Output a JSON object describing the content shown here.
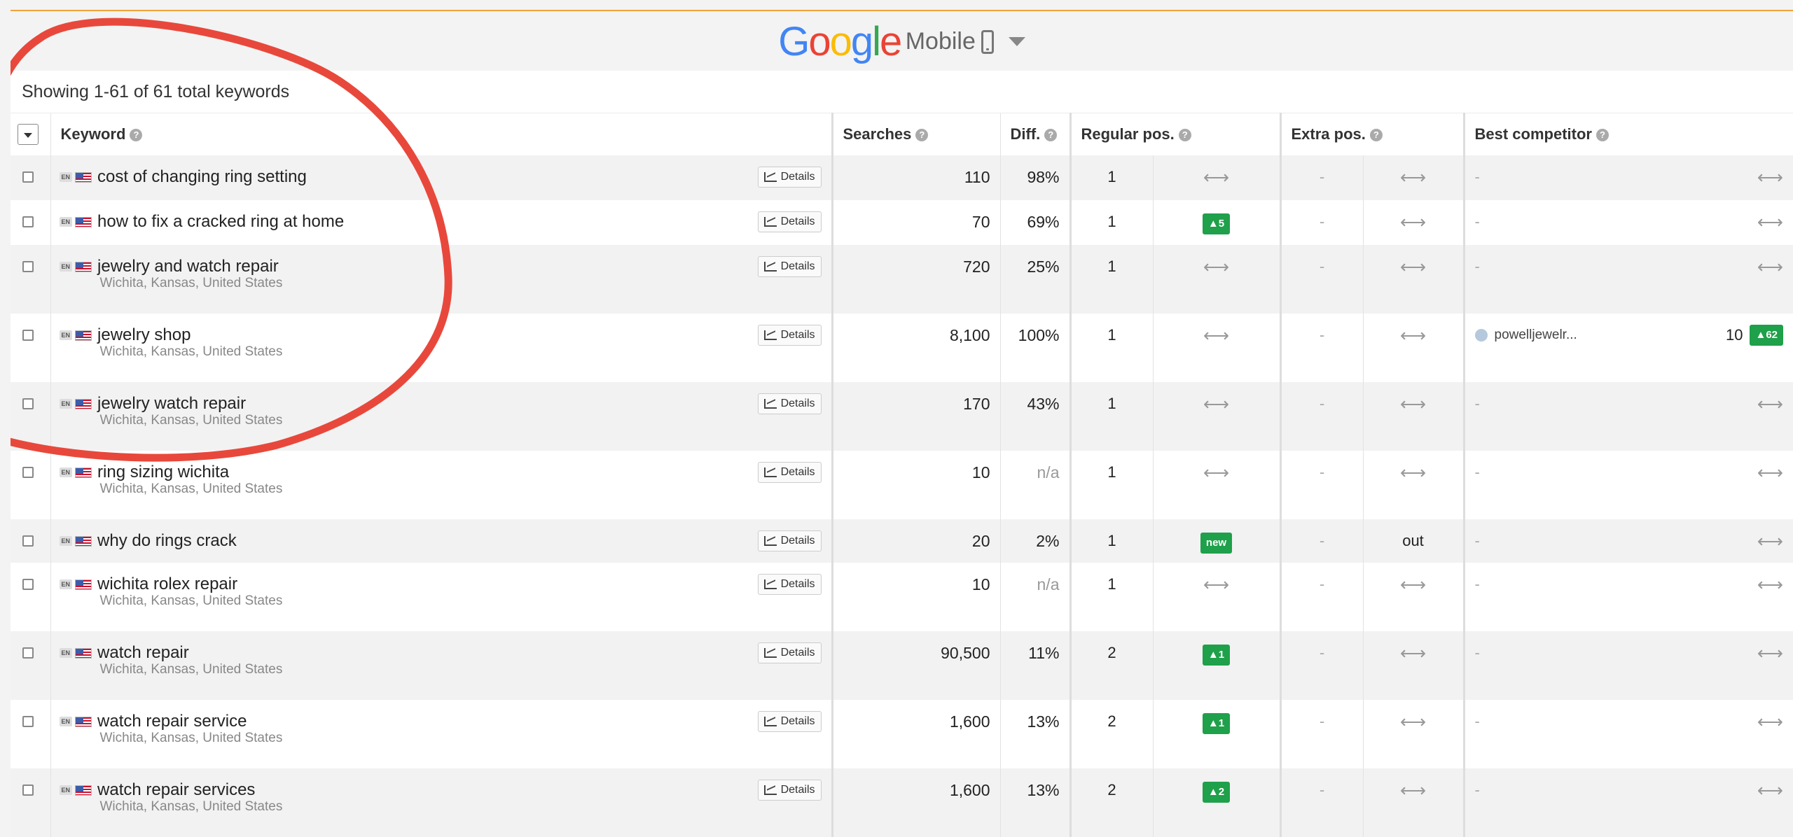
{
  "engine": {
    "logo_letters": [
      {
        "ch": "G",
        "color": "#4285F4"
      },
      {
        "ch": "o",
        "color": "#EA4335"
      },
      {
        "ch": "o",
        "color": "#FBBC05"
      },
      {
        "ch": "g",
        "color": "#4285F4"
      },
      {
        "ch": "l",
        "color": "#34A853"
      },
      {
        "ch": "e",
        "color": "#EA4335"
      }
    ],
    "device": "Mobile"
  },
  "summary": "Showing 1-61 of 61 total keywords",
  "columns": {
    "keyword": "Keyword",
    "searches": "Searches",
    "diff": "Diff.",
    "regular": "Regular pos.",
    "extra": "Extra pos.",
    "competitor": "Best competitor"
  },
  "details_label": "Details",
  "rows": [
    {
      "keyword": "cost of changing ring setting",
      "lang": "EN",
      "location": "",
      "searches": "110",
      "diff": "98%",
      "reg_pos": "1",
      "reg_change": "⟷",
      "reg_badge": "",
      "extra_pos": "-",
      "extra_change": "⟷",
      "comp_name": "-",
      "comp_pos": "",
      "comp_badge": "",
      "comp_change": "⟷"
    },
    {
      "keyword": "how to fix a cracked ring at home",
      "lang": "EN",
      "location": "",
      "searches": "70",
      "diff": "69%",
      "reg_pos": "1",
      "reg_change": "",
      "reg_badge": "▲5",
      "extra_pos": "-",
      "extra_change": "⟷",
      "comp_name": "-",
      "comp_pos": "",
      "comp_badge": "",
      "comp_change": "⟷"
    },
    {
      "keyword": "jewelry and watch repair",
      "lang": "EN",
      "location": "Wichita, Kansas, United States",
      "searches": "720",
      "diff": "25%",
      "reg_pos": "1",
      "reg_change": "⟷",
      "reg_badge": "",
      "extra_pos": "-",
      "extra_change": "⟷",
      "comp_name": "-",
      "comp_pos": "",
      "comp_badge": "",
      "comp_change": "⟷"
    },
    {
      "keyword": "jewelry shop",
      "lang": "EN",
      "location": "Wichita, Kansas, United States",
      "searches": "8,100",
      "diff": "100%",
      "reg_pos": "1",
      "reg_change": "⟷",
      "reg_badge": "",
      "extra_pos": "-",
      "extra_change": "⟷",
      "comp_name": "powelljewelr...",
      "comp_pos": "10",
      "comp_badge": "▲62",
      "comp_change": ""
    },
    {
      "keyword": "jewelry watch repair",
      "lang": "EN",
      "location": "Wichita, Kansas, United States",
      "searches": "170",
      "diff": "43%",
      "reg_pos": "1",
      "reg_change": "⟷",
      "reg_badge": "",
      "extra_pos": "-",
      "extra_change": "⟷",
      "comp_name": "-",
      "comp_pos": "",
      "comp_badge": "",
      "comp_change": "⟷"
    },
    {
      "keyword": "ring sizing wichita",
      "lang": "EN",
      "location": "Wichita, Kansas, United States",
      "searches": "10",
      "diff": "n/a",
      "reg_pos": "1",
      "reg_change": "⟷",
      "reg_badge": "",
      "extra_pos": "-",
      "extra_change": "⟷",
      "comp_name": "-",
      "comp_pos": "",
      "comp_badge": "",
      "comp_change": "⟷"
    },
    {
      "keyword": "why do rings crack",
      "lang": "EN",
      "location": "",
      "searches": "20",
      "diff": "2%",
      "reg_pos": "1",
      "reg_change": "",
      "reg_badge": "new",
      "extra_pos": "-",
      "extra_change": "out",
      "comp_name": "-",
      "comp_pos": "",
      "comp_badge": "",
      "comp_change": "⟷"
    },
    {
      "keyword": "wichita rolex repair",
      "lang": "EN",
      "location": "Wichita, Kansas, United States",
      "searches": "10",
      "diff": "n/a",
      "reg_pos": "1",
      "reg_change": "⟷",
      "reg_badge": "",
      "extra_pos": "-",
      "extra_change": "⟷",
      "comp_name": "-",
      "comp_pos": "",
      "comp_badge": "",
      "comp_change": "⟷"
    },
    {
      "keyword": "watch repair",
      "lang": "EN",
      "location": "Wichita, Kansas, United States",
      "searches": "90,500",
      "diff": "11%",
      "reg_pos": "2",
      "reg_change": "",
      "reg_badge": "▲1",
      "extra_pos": "-",
      "extra_change": "⟷",
      "comp_name": "-",
      "comp_pos": "",
      "comp_badge": "",
      "comp_change": "⟷"
    },
    {
      "keyword": "watch repair service",
      "lang": "EN",
      "location": "Wichita, Kansas, United States",
      "searches": "1,600",
      "diff": "13%",
      "reg_pos": "2",
      "reg_change": "",
      "reg_badge": "▲1",
      "extra_pos": "-",
      "extra_change": "⟷",
      "comp_name": "-",
      "comp_pos": "",
      "comp_badge": "",
      "comp_change": "⟷"
    },
    {
      "keyword": "watch repair services",
      "lang": "EN",
      "location": "Wichita, Kansas, United States",
      "searches": "1,600",
      "diff": "13%",
      "reg_pos": "2",
      "reg_change": "",
      "reg_badge": "▲2",
      "extra_pos": "-",
      "extra_change": "⟷",
      "comp_name": "-",
      "comp_pos": "",
      "comp_badge": "",
      "comp_change": "⟷"
    }
  ],
  "colors": {
    "accent_line": "#f0a33a",
    "badge_green": "#1fa04a",
    "annotation": "#e8483b"
  }
}
